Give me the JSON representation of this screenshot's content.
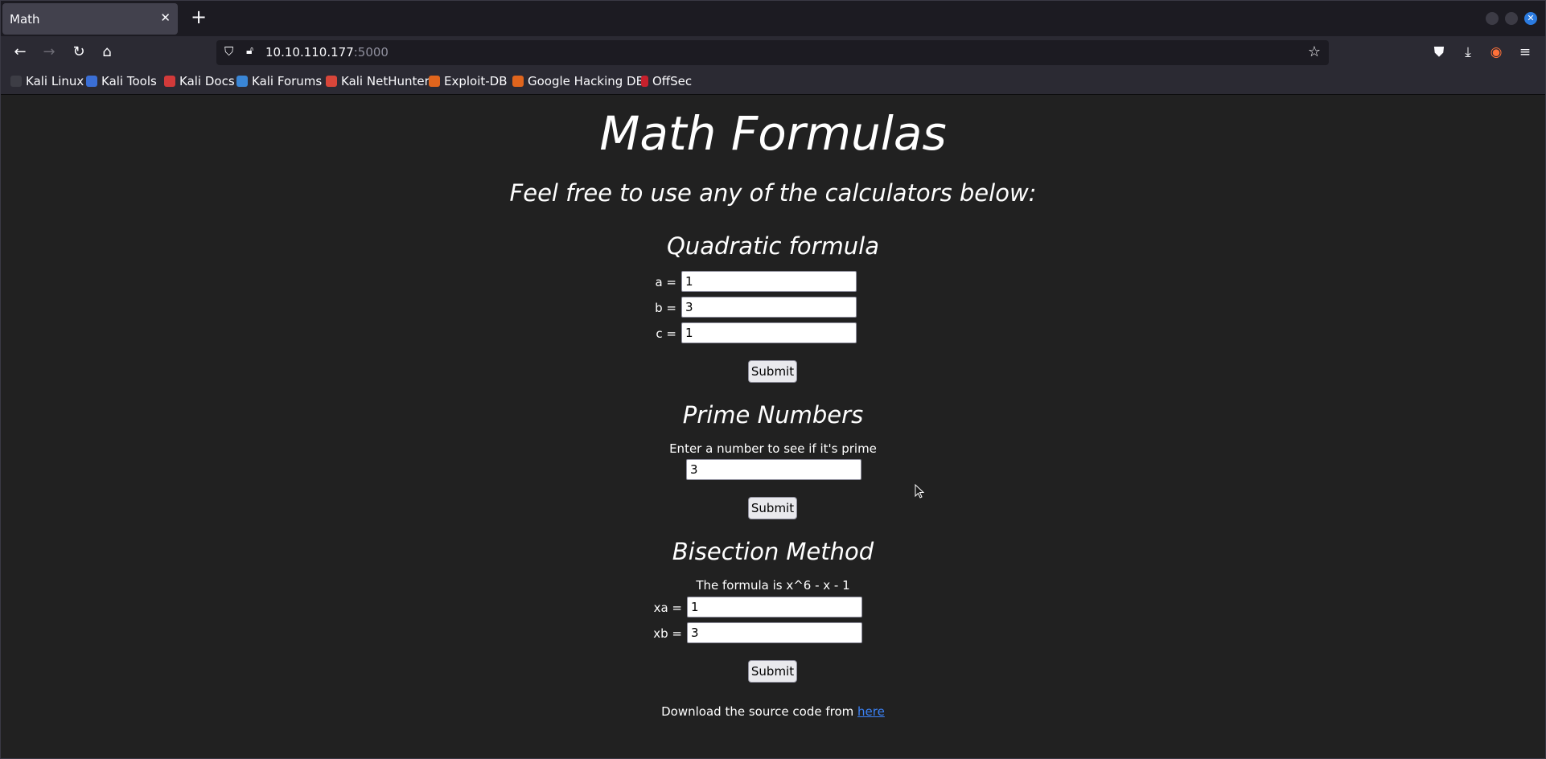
{
  "browser": {
    "tab_title": "Math",
    "url_host": "10.10.110.177",
    "url_port": ":5000",
    "bookmarks": [
      "Kali Linux",
      "Kali Tools",
      "Kali Docs",
      "Kali Forums",
      "Kali NetHunter",
      "Exploit-DB",
      "Google Hacking DB",
      "OffSec"
    ],
    "icons": {
      "tab_close": "close-icon",
      "new_tab": "plus-icon",
      "back": "back-arrow-icon",
      "forward": "forward-arrow-icon",
      "reload": "reload-icon",
      "home": "home-icon",
      "shield": "shield-icon",
      "lock": "lock-icon",
      "star": "bookmark-star-icon",
      "pocket": "pocket-icon",
      "downloads": "download-icon",
      "extension": "firefox-account-icon",
      "menu": "hamburger-menu-icon"
    },
    "colors": {
      "accent": "#2b7be0",
      "page_bg": "#212121",
      "link": "#3b82f6"
    }
  },
  "page": {
    "title": "Math Formulas",
    "subtitle": "Feel free to use any of the calculators below:",
    "quadratic": {
      "heading": "Quadratic formula",
      "a_label": "a =",
      "a_value": "1",
      "b_label": "b =",
      "b_value": "3",
      "c_label": "c =",
      "c_value": "1",
      "submit": "Submit"
    },
    "prime": {
      "heading": "Prime Numbers",
      "description": "Enter a number to see if it's prime",
      "value": "3",
      "submit": "Submit"
    },
    "bisection": {
      "heading": "Bisection Method",
      "description": "The formula is x^6 - x - 1",
      "xa_label": "xa =",
      "xa_value": "1",
      "xb_label": "xb =",
      "xb_value": "3",
      "submit": "Submit"
    },
    "footer": {
      "text": "Download the source code from ",
      "link": "here"
    }
  }
}
